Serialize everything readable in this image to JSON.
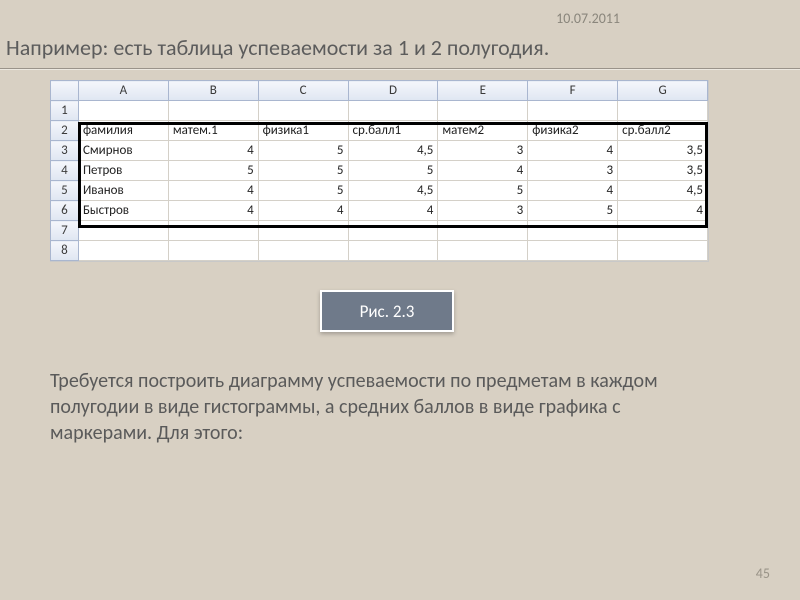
{
  "date": "10.07.2011",
  "title": "Например: есть таблица успеваемости за 1 и 2 полугодия.",
  "caption": "Рис. 2.3",
  "paragraph": "Требуется построить диаграмму успеваемости по предметам в каждом полугодии в виде гистограммы, а средних баллов в виде графика с маркерами. Для этого:",
  "page_number": "45",
  "spreadsheet": {
    "columns": [
      "A",
      "B",
      "C",
      "D",
      "E",
      "F",
      "G"
    ],
    "row_numbers": [
      "1",
      "2",
      "3",
      "4",
      "5",
      "6",
      "7",
      "8"
    ],
    "headers": [
      "фамилия",
      "матем.1",
      "физика1",
      "ср.балл1",
      "матем2",
      "физика2",
      "ср.балл2"
    ],
    "data": [
      {
        "name": "Смирнов",
        "m1": "4",
        "f1": "5",
        "avg1": "4,5",
        "m2": "3",
        "f2": "4",
        "avg2": "3,5"
      },
      {
        "name": "Петров",
        "m1": "5",
        "f1": "5",
        "avg1": "5",
        "m2": "4",
        "f2": "3",
        "avg2": "3,5"
      },
      {
        "name": "Иванов",
        "m1": "4",
        "f1": "5",
        "avg1": "4,5",
        "m2": "5",
        "f2": "4",
        "avg2": "4,5"
      },
      {
        "name": "Быстров",
        "m1": "4",
        "f1": "4",
        "avg1": "4",
        "m2": "3",
        "f2": "5",
        "avg2": "4"
      }
    ]
  },
  "chart_data": {
    "type": "table",
    "title": "Таблица успеваемости за 1 и 2 полугодия",
    "columns": [
      "фамилия",
      "матем.1",
      "физика1",
      "ср.балл1",
      "матем2",
      "физика2",
      "ср.балл2"
    ],
    "rows": [
      [
        "Смирнов",
        4,
        5,
        4.5,
        3,
        4,
        3.5
      ],
      [
        "Петров",
        5,
        5,
        5,
        4,
        3,
        3.5
      ],
      [
        "Иванов",
        4,
        5,
        4.5,
        5,
        4,
        4.5
      ],
      [
        "Быстров",
        4,
        4,
        4,
        3,
        5,
        4
      ]
    ]
  }
}
